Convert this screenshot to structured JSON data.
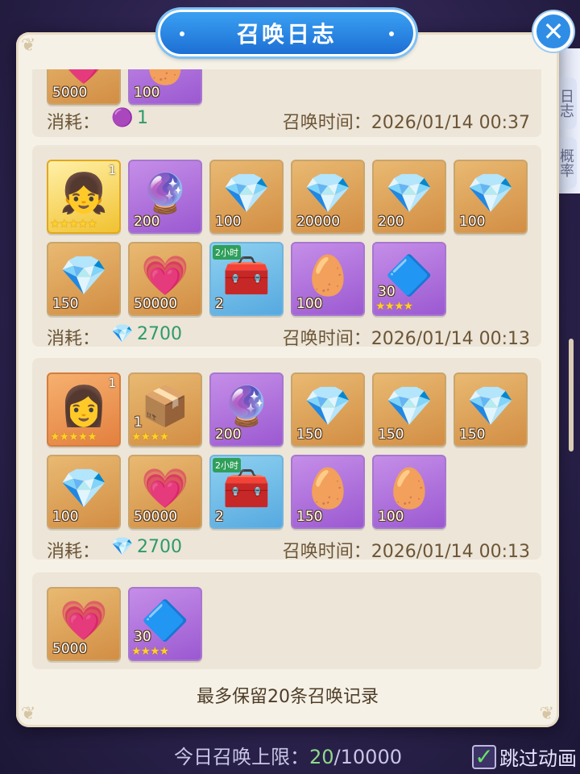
{
  "title": "召唤日志",
  "side_tabs": [
    "日志",
    "概率"
  ],
  "footer_note": "最多保留20条召唤记录",
  "bottom": {
    "daily_limit_label": "今日召唤上限：",
    "daily_count": "20",
    "daily_max": "/10000",
    "skip_label": "跳过动画",
    "skip_checked": "✓"
  },
  "records": [
    {
      "cost_label": "消耗：",
      "cost_icon": "purple-orb-icon",
      "cost_value": "1",
      "time": "召唤时间：2026/01/14 00:37",
      "items": [
        {
          "icon": "experience-heart-icon",
          "glyph": "💗",
          "qty": "5000",
          "frame": "gold"
        },
        {
          "icon": "gold-egg-icon",
          "glyph": "🥚",
          "qty": "100",
          "frame": "purple"
        }
      ]
    },
    {
      "cost_label": "消耗：",
      "cost_icon": "crystal-gem-icon",
      "cost_value": "2700",
      "time": "召唤时间：2026/01/14 00:13",
      "items": [
        {
          "icon": "hero-portrait-icon",
          "glyph": "👧",
          "qty": "",
          "corner": "1",
          "stars": "★★★★★",
          "frame": "hero-gold"
        },
        {
          "icon": "crystal-ball-icon",
          "glyph": "🔮",
          "qty": "200",
          "frame": "purple"
        },
        {
          "icon": "crystal-gem-icon",
          "glyph": "💎",
          "qty": "100",
          "frame": "gold"
        },
        {
          "icon": "crystal-gem-icon",
          "glyph": "💎",
          "qty": "20000",
          "frame": "gold"
        },
        {
          "icon": "crystal-gem-icon",
          "glyph": "💎",
          "qty": "200",
          "frame": "gold"
        },
        {
          "icon": "crystal-gem-icon",
          "glyph": "💎",
          "qty": "100",
          "frame": "gold"
        },
        {
          "icon": "crystal-gem-icon",
          "glyph": "💎",
          "qty": "150",
          "frame": "gold"
        },
        {
          "icon": "experience-heart-icon",
          "glyph": "💗",
          "qty": "50000",
          "frame": "gold"
        },
        {
          "icon": "treasure-chest-icon",
          "glyph": "🧰",
          "qty": "2",
          "tag": "2小时",
          "frame": "blue"
        },
        {
          "icon": "gold-egg-icon",
          "glyph": "🥚",
          "qty": "100",
          "frame": "purple"
        },
        {
          "icon": "purple-shard-icon",
          "glyph": "🔷",
          "qty": "30",
          "stars": "★★★★",
          "frame": "purple"
        }
      ]
    },
    {
      "cost_label": "消耗：",
      "cost_icon": "crystal-gem-icon",
      "cost_value": "2700",
      "time": "召唤时间：2026/01/14 00:13",
      "items": [
        {
          "icon": "hero-portrait-icon",
          "glyph": "👩",
          "qty": "",
          "corner": "1",
          "stars": "★★★★★",
          "frame": "hero-orange"
        },
        {
          "icon": "mystery-crate-icon",
          "glyph": "📦",
          "qty": "1",
          "stars": "★★★★",
          "frame": "gold"
        },
        {
          "icon": "crystal-ball-icon",
          "glyph": "🔮",
          "qty": "200",
          "frame": "purple"
        },
        {
          "icon": "crystal-gem-icon",
          "glyph": "💎",
          "qty": "150",
          "frame": "gold"
        },
        {
          "icon": "crystal-gem-icon",
          "glyph": "💎",
          "qty": "150",
          "frame": "gold"
        },
        {
          "icon": "crystal-gem-icon",
          "glyph": "💎",
          "qty": "150",
          "frame": "gold"
        },
        {
          "icon": "crystal-gem-icon",
          "glyph": "💎",
          "qty": "100",
          "frame": "gold"
        },
        {
          "icon": "experience-heart-icon",
          "glyph": "💗",
          "qty": "50000",
          "frame": "gold"
        },
        {
          "icon": "treasure-chest-icon",
          "glyph": "🧰",
          "qty": "2",
          "tag": "2小时",
          "frame": "blue"
        },
        {
          "icon": "gold-egg-icon",
          "glyph": "🥚",
          "qty": "150",
          "frame": "purple"
        },
        {
          "icon": "gold-egg-icon",
          "glyph": "🥚",
          "qty": "100",
          "frame": "purple"
        }
      ]
    },
    {
      "cost_label": "",
      "cost_icon": "",
      "cost_value": "",
      "time": "",
      "items": [
        {
          "icon": "experience-heart-icon",
          "glyph": "💗",
          "qty": "5000",
          "frame": "gold"
        },
        {
          "icon": "purple-shard-icon",
          "glyph": "🔷",
          "qty": "30",
          "stars": "★★★★",
          "frame": "purple"
        }
      ]
    }
  ]
}
